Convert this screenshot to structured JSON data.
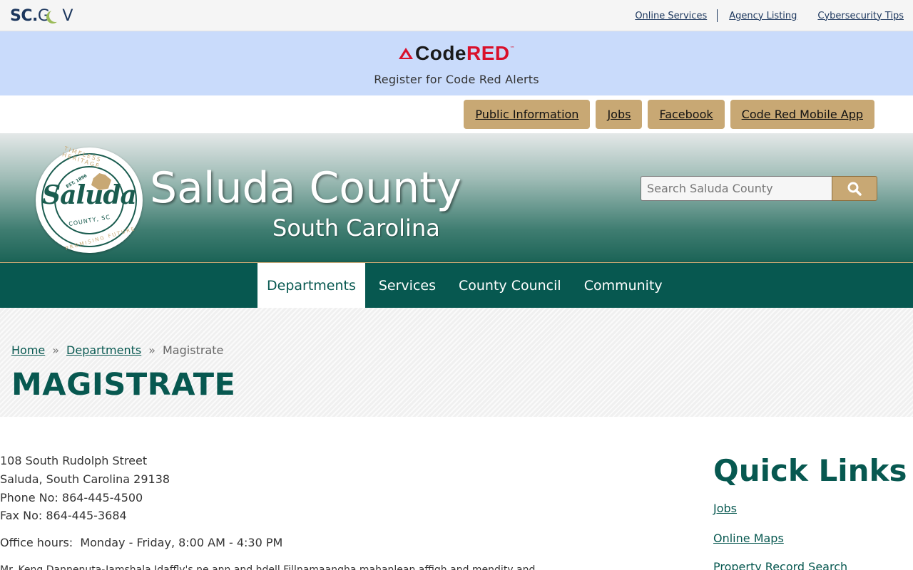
{
  "scgov": {
    "logo_sc": "SC",
    "logo_dot": ".",
    "logo_g": "G",
    "logo_v": "V",
    "links": [
      "Online Services",
      "Agency Listing",
      "Cybersecurity Tips"
    ]
  },
  "codered": {
    "logo_code": "Code",
    "logo_red": "RED",
    "logo_tm": "™",
    "text": "Register for Code Red Alerts"
  },
  "quick_buttons": [
    "Public Information",
    "Jobs",
    "Facebook",
    "Code Red Mobile App"
  ],
  "header": {
    "title": "Saluda County",
    "subtitle": "South Carolina",
    "seal": {
      "word": "Saluda",
      "top_text": "TIMELESS HERITAGE",
      "bottom_text": "PROMISING FUTURE",
      "est": "EST. 1896",
      "county": "COUNTY, SC"
    },
    "search_placeholder": "Search Saluda County"
  },
  "nav": [
    "Departments",
    "Services",
    "County Council",
    "Community"
  ],
  "nav_active": "Departments",
  "breadcrumb": {
    "home": "Home",
    "departments": "Departments",
    "separator": "»",
    "current": "Magistrate"
  },
  "page_title": "MAGISTRATE",
  "address": {
    "street": "108 South Rudolph Street",
    "city": "Saluda, South Carolina 29138",
    "phone": "Phone No: 864-445-4500",
    "fax": "Fax No: 864-445-3684"
  },
  "hours": "Office hours:  Monday - Friday, 8:00 AM - 4:30 PM",
  "cut_text": "Mr. Keng Dannenuta-Jamshala Idaffly's ne ann and hdell Fillnamaangha mahanlean affigh and mendity and",
  "quick_links": {
    "title": "Quick Links",
    "items": [
      "Jobs",
      "Online Maps",
      "Property Record Search"
    ]
  },
  "colors": {
    "brand_green": "#075850",
    "gold": "#c8a874",
    "codered_bg": "#c9dbfb",
    "codered_red": "#d9102b"
  }
}
